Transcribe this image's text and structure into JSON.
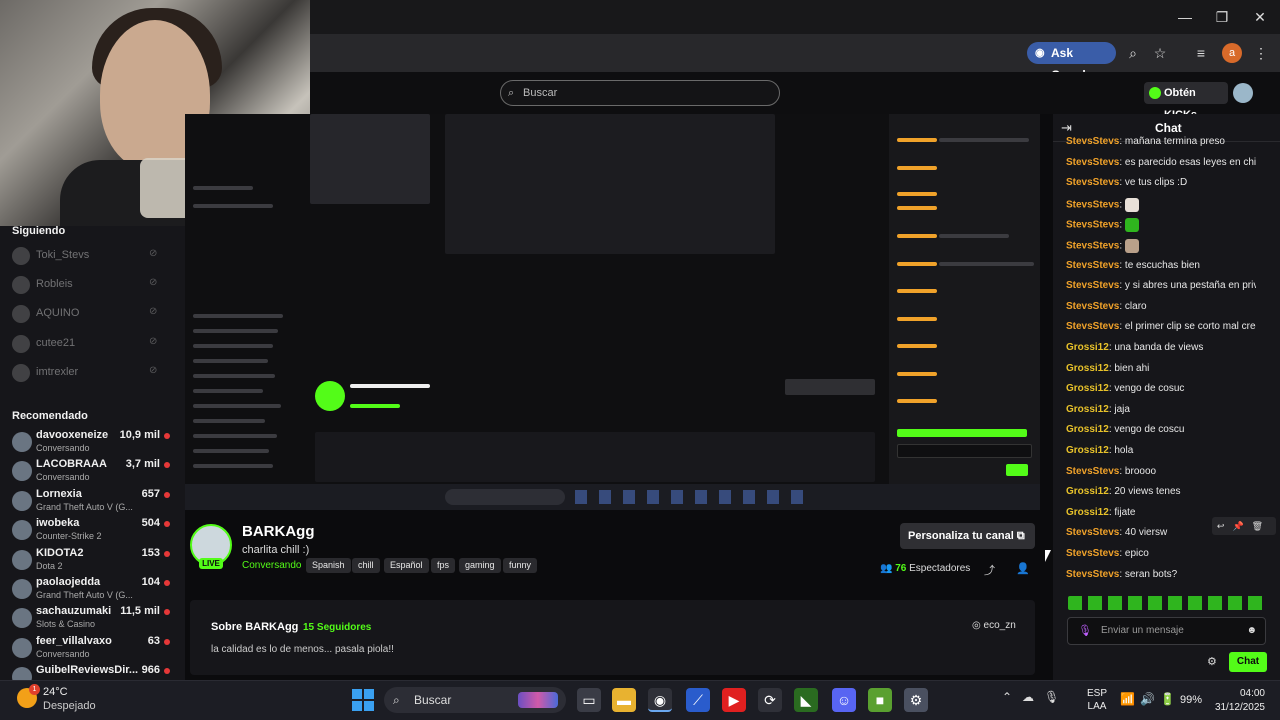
{
  "browser": {
    "ask_google": "Ask Google",
    "profile_initial": "a"
  },
  "kick": {
    "search_placeholder": "Buscar",
    "kicks_button": "Obtén KICKs"
  },
  "sidebar": {
    "following_heading": "Siguiendo",
    "following": [
      {
        "name": "Toki_Stevs"
      },
      {
        "name": "Robleis"
      },
      {
        "name": "AQUINO"
      },
      {
        "name": "cutee21"
      },
      {
        "name": "imtrexler"
      }
    ],
    "recommended_heading": "Recomendado",
    "recommended": [
      {
        "name": "davooxeneize",
        "category": "Conversando",
        "viewers": "10,9 mil"
      },
      {
        "name": "LACOBRAAA",
        "category": "Conversando",
        "viewers": "3,7 mil"
      },
      {
        "name": "Lornexia",
        "category": "Grand Theft Auto V (G...",
        "viewers": "657"
      },
      {
        "name": "iwobeka",
        "category": "Counter-Strike 2",
        "viewers": "504"
      },
      {
        "name": "KIDOTA2",
        "category": "Dota 2",
        "viewers": "153"
      },
      {
        "name": "paolaojedda",
        "category": "Grand Theft Auto V (G...",
        "viewers": "104"
      },
      {
        "name": "sachauzumaki",
        "category": "Slots & Casino",
        "viewers": "11,5 mil"
      },
      {
        "name": "feer_villalvaxo",
        "category": "Conversando",
        "viewers": "63"
      },
      {
        "name": "GuibelReviewsDir...",
        "category": "",
        "viewers": "966"
      }
    ]
  },
  "channel": {
    "name": "BARKAgg",
    "live_badge": "LIVE",
    "title": "charlita chill :)",
    "category": "Conversando",
    "tags": [
      "Spanish",
      "chill",
      "Español",
      "fps",
      "gaming",
      "funny"
    ],
    "personaliza": "Personaliza tu canal",
    "viewers_count": "76",
    "viewers_label": "Espectadores",
    "about_title": "Sobre BARKAgg",
    "followers": "15 Seguidores",
    "description": "la calidad es lo de menos... pasala piola!!",
    "instagram": "eco_zn"
  },
  "chat": {
    "title": "Chat",
    "messages": [
      {
        "user": "StevsStevs",
        "text": ": mañana termina preso"
      },
      {
        "user": "StevsStevs",
        "text": ": es parecido esas leyes en chile cu"
      },
      {
        "user": "StevsStevs",
        "text": ": ve tus clips :D"
      },
      {
        "user": "StevsStevs",
        "text": ":"
      },
      {
        "user": "StevsStevs",
        "text": ":"
      },
      {
        "user": "StevsStevs",
        "text": ":"
      },
      {
        "user": "StevsStevs",
        "text": ": te escuchas bien"
      },
      {
        "user": "StevsStevs",
        "text": ": y si abres una pestaña en privado?"
      },
      {
        "user": "StevsStevs",
        "text": ": claro"
      },
      {
        "user": "StevsStevs",
        "text": ": el primer clip se corto mal creo"
      },
      {
        "user": "Grossi12",
        "text": ": una banda de views"
      },
      {
        "user": "Grossi12",
        "text": ": bien ahi"
      },
      {
        "user": "Grossi12",
        "text": ": vengo de cosuc"
      },
      {
        "user": "Grossi12",
        "text": ": jaja"
      },
      {
        "user": "Grossi12",
        "text": ": vengo de coscu"
      },
      {
        "user": "Grossi12",
        "text": ": hola"
      },
      {
        "user": "StevsStevs",
        "text": ": broooo"
      },
      {
        "user": "Grossi12",
        "text": ": 20 views tenes"
      },
      {
        "user": "Grossi12",
        "text": ": fijate"
      },
      {
        "user": "StevsStevs",
        "text": ": 40 viersw"
      },
      {
        "user": "StevsStevs",
        "text": ": epico"
      },
      {
        "user": "StevsStevs",
        "text": ": seran bots?"
      }
    ],
    "input_placeholder": "Enviar un mensaje",
    "send_label": "Chat"
  },
  "taskbar": {
    "temperature": "24°C",
    "weather": "Despejado",
    "weather_badge": "1",
    "search_label": "Buscar",
    "lang_line1": "ESP",
    "lang_line2": "LAA",
    "battery": "99%",
    "time": "04:00",
    "date": "31/12/2025"
  },
  "colors": {
    "kick_green": "#53fc18",
    "steve_color": "#f0a22a",
    "grossi_color": "#e8c22a"
  }
}
